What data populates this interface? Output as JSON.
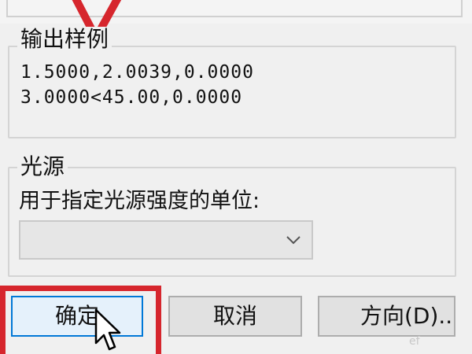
{
  "output_sample": {
    "label": "输出样例",
    "line1": "1.5000,2.0039,0.0000",
    "line2": "3.0000<45.00,0.0000"
  },
  "light_source": {
    "label": "光源",
    "units_caption": "用于指定光源强度的单位:",
    "units_value": ""
  },
  "buttons": {
    "ok": "确定",
    "cancel": "取消",
    "direction": "方向(D)..."
  },
  "icons": {
    "combo_arrow": "chevron-down-icon",
    "cursor": "mouse-pointer-icon"
  },
  "colors": {
    "highlight_red": "#d6262d",
    "focus_blue": "#0078d7",
    "dialog_bg": "#f0f0f0"
  },
  "watermark": "ef"
}
